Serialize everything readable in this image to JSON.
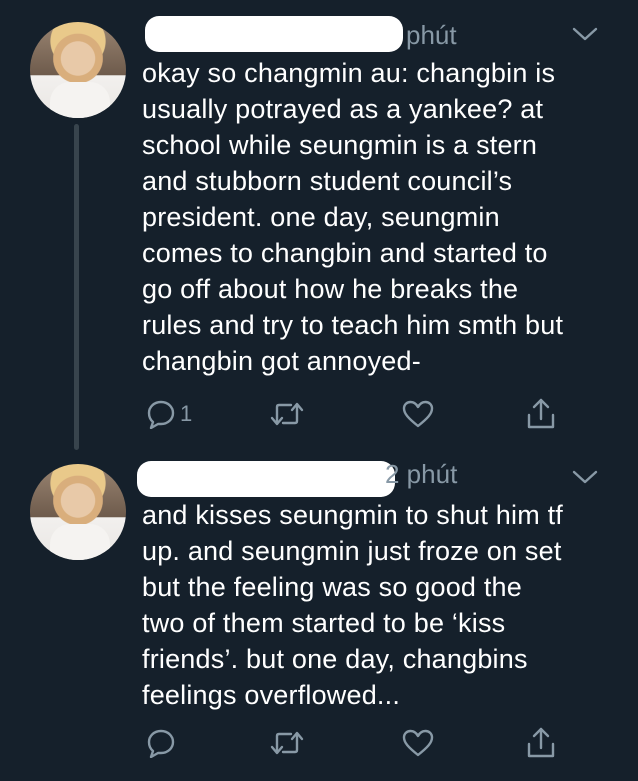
{
  "tweets": [
    {
      "time": "phút",
      "text": "okay so changmin au: changbin is\nusually potrayed as a yankee? at\nschool while seungmin is a stern\nand stubborn student council’s\npresident. one day, seungmin\ncomes to changbin and started to\ngo off about how he breaks the\nrules and try to teach him smth but\nchangbin got annoyed-",
      "reply_count": "1"
    },
    {
      "time": "2 phút",
      "text": "and kisses seungmin to shut him tf\nup. and seungmin just froze on set\nbut the feeling was so good the\ntwo of them started to be ‘kiss\nfriends’. but one day, changbins\nfeelings overflowed...",
      "reply_count": ""
    }
  ],
  "colors": {
    "background": "#15202b",
    "text": "#ffffff",
    "secondary": "#8899a6",
    "thread_line": "#38444d"
  },
  "icons": [
    "reply-icon",
    "retweet-icon",
    "like-icon",
    "share-icon",
    "chevron-down-icon"
  ]
}
